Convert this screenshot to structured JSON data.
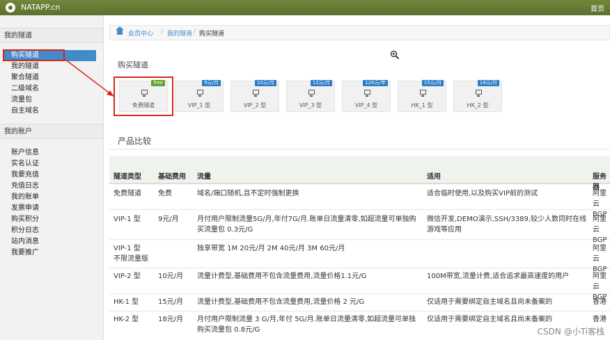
{
  "topbar": {
    "brand": "NATAPP.cn",
    "home": "首页"
  },
  "sidebar": {
    "section1_title": "我的隧道",
    "section1_items": [
      "购买隧道",
      "我的隧道",
      "聚合隧道",
      "二级域名",
      "流量包",
      "自主域名"
    ],
    "section2_title": "我的账户",
    "section2_items": [
      "账户信息",
      "实名认证",
      "我要充值",
      "充值日志",
      "我的账单",
      "发票申请",
      "购买积分",
      "积分日志",
      "站内消息",
      "我要推广"
    ]
  },
  "breadcrumb": {
    "items": [
      "会员中心",
      "我的隧道",
      "购买隧道"
    ]
  },
  "page": {
    "heading": "购买隧道",
    "compare_title": "产品比较"
  },
  "tunnels": [
    {
      "name": "免费隧道",
      "price": "free"
    },
    {
      "name": "VIP_1 型",
      "price": "9元/月"
    },
    {
      "name": "VIP_2 型",
      "price": "10元/月"
    },
    {
      "name": "VIP_3 型",
      "price": "12元/月"
    },
    {
      "name": "VIP_4 型",
      "price": "120元/年"
    },
    {
      "name": "HK_1 型",
      "price": "15元/月"
    },
    {
      "name": "HK_2 型",
      "price": "18元/月"
    }
  ],
  "table": {
    "headers": [
      "隧道类型",
      "基础费用",
      "流量",
      "适用",
      "服务器"
    ],
    "rows": [
      {
        "type": "免费隧道",
        "fee": "免费",
        "traffic": "域名/端口随机,且不定时强制更换",
        "usage": "适合临时使用,以及购买VIP前的测试",
        "server": "阿里云\nBGP"
      },
      {
        "type": "VIP-1 型",
        "fee": "9元/月",
        "traffic": "月付用户限制流量5G/月,年付7G/月.账单日流量清零,如超流量可单独购买流量包 0.3元/G",
        "usage": "微信开发,DEMO演示,SSH/3389,较少人数同时在线游戏等应用",
        "server": "阿里云\nBGP"
      },
      {
        "type": "VIP-1 型\n不限流量版",
        "fee": "",
        "traffic": "独享带宽 1M 20元/月 2M 40元/月 3M 60元/月",
        "usage": "",
        "server": "阿里云\nBGP"
      },
      {
        "type": "VIP-2 型",
        "fee": "10元/月",
        "traffic": "流量计费型,基础费用不包含流量费用,流量价格1.1元/G",
        "usage": "100M带宽,流量计费,适合追求最高速度的用户",
        "server": "阿里云\nBGP"
      },
      {
        "type": "HK-1 型",
        "fee": "15元/月",
        "traffic": "流量计费型,基础费用不包含流量费用,流量价格 2 元/G",
        "usage": "仅适用于需要绑定自主域名且尚未备案的",
        "server": "香港"
      },
      {
        "type": "HK-2 型",
        "fee": "18元/月",
        "traffic": "月付用户限制流量 3 G/月,年付 5G/月.账单日流量清零,如超流量可单独购买流量包 0.8元/G",
        "usage": "仅适用于需要绑定自主域名且尚未备案的",
        "server": "香港"
      }
    ]
  },
  "watermark": "CSDN @小Ti客栈",
  "colors": {
    "topbar": "#5d7130",
    "active": "#428bca",
    "highlight": "#d9261c",
    "badge": "#2a7cc7",
    "free_badge": "#5fa32b"
  }
}
